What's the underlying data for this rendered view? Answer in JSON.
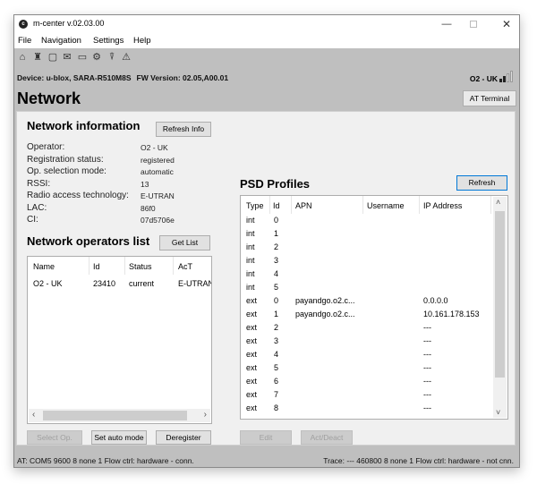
{
  "window": {
    "title": "m-center v.02.03.00",
    "app_icon_letter": "c",
    "controls": {
      "minimize": "—",
      "close": "✕"
    }
  },
  "menu": [
    "File",
    "Navigation",
    "Settings",
    "Help"
  ],
  "toolbar_icons": [
    {
      "name": "home-icon",
      "glyph": "⌂"
    },
    {
      "name": "tower-icon",
      "glyph": "♜"
    },
    {
      "name": "sim-icon",
      "glyph": "▢"
    },
    {
      "name": "message-icon",
      "glyph": "✉"
    },
    {
      "name": "folder-icon",
      "glyph": "▭"
    },
    {
      "name": "settings-gear-icon",
      "glyph": "⚙"
    },
    {
      "name": "gps-icon",
      "glyph": "⍒"
    },
    {
      "name": "warning-icon",
      "glyph": "⚠"
    }
  ],
  "device": {
    "device_text": "Device: u-blox, SARA-R510M8S",
    "fw_text": "FW Version: 02.05,A00.01",
    "operator_badge": "O2 - UK",
    "signal_bars_on": 2,
    "signal_bars_total": 4
  },
  "page": {
    "title": "Network",
    "at_terminal_label": "AT Terminal"
  },
  "network_info": {
    "title": "Network information",
    "refresh_label": "Refresh Info",
    "fields": [
      {
        "label": "Operator:",
        "value": "O2 - UK"
      },
      {
        "label": "Registration status:",
        "value": "registered"
      },
      {
        "label": "Op. selection mode:",
        "value": "automatic"
      },
      {
        "label": "RSSI:",
        "value": "13"
      },
      {
        "label": "Radio access technology:",
        "value": "E-UTRAN"
      },
      {
        "label": "LAC:",
        "value": "86f0"
      },
      {
        "label": "CI:",
        "value": "07d5706e"
      }
    ]
  },
  "operators": {
    "title": "Network operators list",
    "get_list_label": "Get List",
    "columns": [
      "Name",
      "Id",
      "Status",
      "AcT"
    ],
    "rows": [
      [
        "O2 - UK",
        "23410",
        "current",
        "E-UTRAN"
      ]
    ],
    "buttons": {
      "select_op": "Select Op.",
      "set_auto": "Set auto mode",
      "deregister": "Deregister"
    }
  },
  "psd": {
    "title": "PSD Profiles",
    "refresh_label": "Refresh",
    "columns": [
      "Type",
      "Id",
      "APN",
      "Username",
      "IP Address"
    ],
    "rows": [
      [
        "int",
        "0",
        "",
        "",
        ""
      ],
      [
        "int",
        "1",
        "",
        "",
        ""
      ],
      [
        "int",
        "2",
        "",
        "",
        ""
      ],
      [
        "int",
        "3",
        "",
        "",
        ""
      ],
      [
        "int",
        "4",
        "",
        "",
        ""
      ],
      [
        "int",
        "5",
        "",
        "",
        ""
      ],
      [
        "ext",
        "0",
        "payandgo.o2.c...",
        "",
        "0.0.0.0"
      ],
      [
        "ext",
        "1",
        "payandgo.o2.c...",
        "",
        "10.161.178.153"
      ],
      [
        "ext",
        "2",
        "",
        "",
        "---"
      ],
      [
        "ext",
        "3",
        "",
        "",
        "---"
      ],
      [
        "ext",
        "4",
        "",
        "",
        "---"
      ],
      [
        "ext",
        "5",
        "",
        "",
        "---"
      ],
      [
        "ext",
        "6",
        "",
        "",
        "---"
      ],
      [
        "ext",
        "7",
        "",
        "",
        "---"
      ],
      [
        "ext",
        "8",
        "",
        "",
        "---"
      ]
    ],
    "buttons": {
      "edit": "Edit",
      "act_deact": "Act/Deact"
    }
  },
  "status": {
    "left": "AT: COM5 9600 8 none 1 Flow ctrl: hardware - conn.",
    "right": "Trace: --- 460800 8 none 1 Flow ctrl: hardware - not cnn."
  }
}
